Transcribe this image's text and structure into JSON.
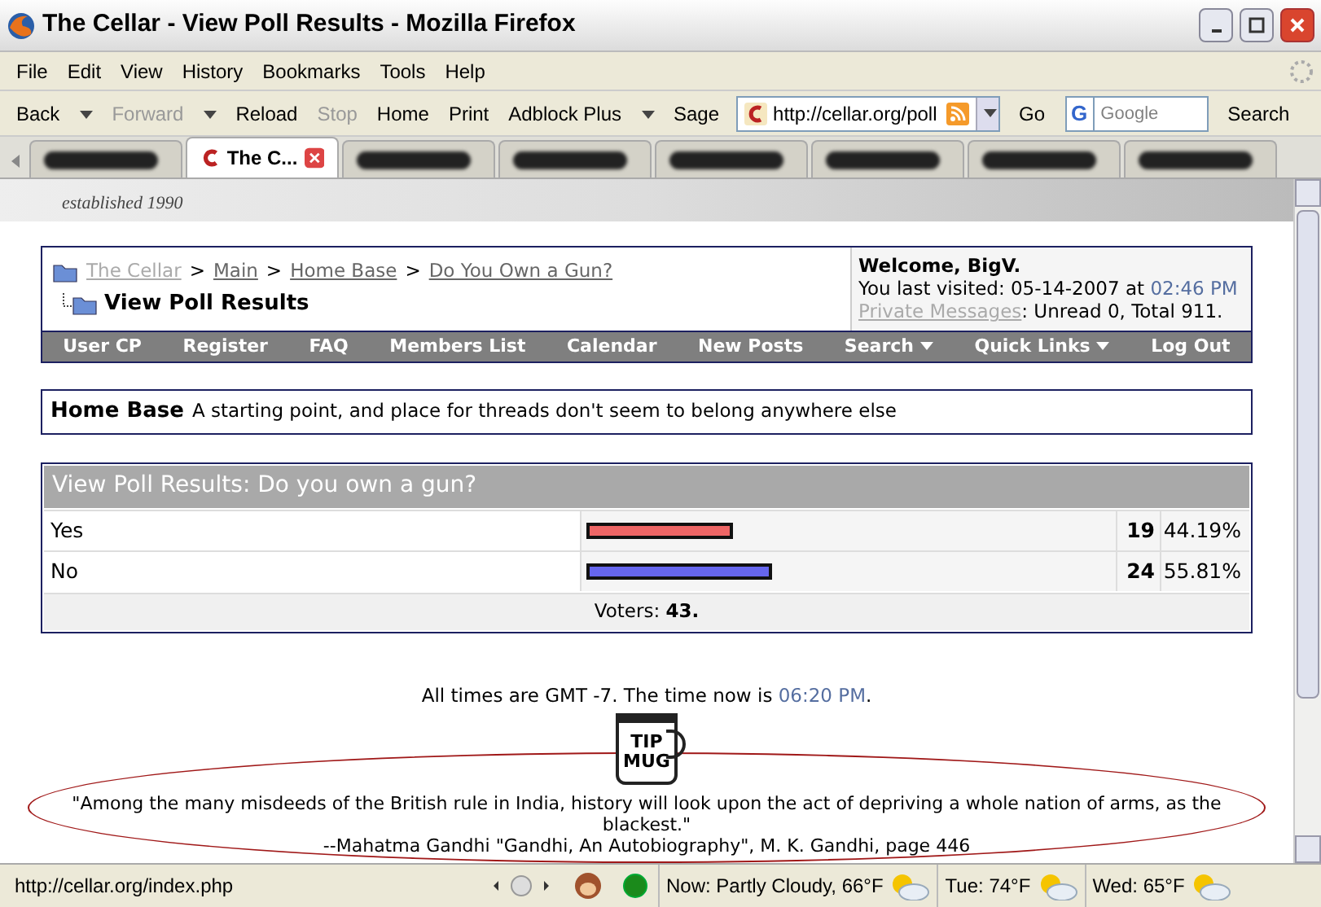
{
  "window": {
    "title": "The Cellar - View Poll Results - Mozilla Firefox"
  },
  "menu": [
    "File",
    "Edit",
    "View",
    "History",
    "Bookmarks",
    "Tools",
    "Help"
  ],
  "toolbar": [
    {
      "label": "Back",
      "disabled": false,
      "dropdown": true
    },
    {
      "label": "Forward",
      "disabled": true,
      "dropdown": true
    },
    {
      "label": "Reload",
      "disabled": false,
      "dropdown": false
    },
    {
      "label": "Stop",
      "disabled": true,
      "dropdown": false
    },
    {
      "label": "Home",
      "disabled": false,
      "dropdown": false
    },
    {
      "label": "Print",
      "disabled": false,
      "dropdown": false
    },
    {
      "label": "Adblock Plus",
      "disabled": false,
      "dropdown": true
    },
    {
      "label": "Sage",
      "disabled": false,
      "dropdown": false
    }
  ],
  "address": {
    "value": "http://cellar.org/poll",
    "go": "Go"
  },
  "search": {
    "engine": "G",
    "placeholder": "Google",
    "button": "Search"
  },
  "tabs": [
    {
      "selected": false
    },
    {
      "label": "The C...",
      "selected": true
    },
    {
      "selected": false
    },
    {
      "selected": false
    },
    {
      "selected": false
    },
    {
      "selected": false
    },
    {
      "selected": false
    },
    {
      "selected": false
    }
  ],
  "header": {
    "tagline": "established 1990"
  },
  "breadcrumb": {
    "links": [
      "The Cellar",
      "Main",
      "Home Base",
      "Do You Own a Gun?"
    ],
    "separator": ">",
    "current": "View Poll Results"
  },
  "welcome": {
    "greeting": "Welcome, BigV.",
    "visited": "You last visited: 05-14-2007 at",
    "visited_time": "02:46 PM",
    "pm_link": "Private Messages",
    "pm_text": ": Unread 0, Total 911."
  },
  "navbar": [
    {
      "label": "User CP",
      "dropdown": false
    },
    {
      "label": "Register",
      "dropdown": false
    },
    {
      "label": "FAQ",
      "dropdown": false
    },
    {
      "label": "Members List",
      "dropdown": false
    },
    {
      "label": "Calendar",
      "dropdown": false
    },
    {
      "label": "New Posts",
      "dropdown": false
    },
    {
      "label": "Search",
      "dropdown": true
    },
    {
      "label": "Quick Links",
      "dropdown": true
    },
    {
      "label": "Log Out",
      "dropdown": false
    }
  ],
  "forum": {
    "name": "Home Base",
    "description": "A starting point, and place for threads don't seem to belong anywhere else"
  },
  "poll": {
    "title": "View Poll Results: Do you own a gun?",
    "options": [
      {
        "label": "Yes",
        "votes": "19",
        "percent": "44.19%",
        "level": 0.28,
        "color": "#ee6666"
      },
      {
        "label": "No",
        "votes": "24",
        "percent": "55.81%",
        "level": 0.355,
        "color": "#6666ee"
      }
    ],
    "voters_label": "Voters:",
    "voters": "43."
  },
  "footer": {
    "times": "All times are GMT -7. The time now is",
    "time": "06:20 PM",
    "time_end": ".",
    "mug": [
      "TIP",
      "MUG"
    ],
    "quote": "\"Among the many misdeeds of the British rule in India, history will look upon the act of depriving a whole nation of arms, as the blackest.\"",
    "attribution": "--Mahatma Gandhi \"Gandhi, An Autobiography\", M. K. Gandhi, page 446"
  },
  "status_bar": {
    "url": "http://cellar.org/index.php",
    "weather": [
      {
        "label": "Now: Partly Cloudy, 66°F"
      },
      {
        "label": "Tue: 74°F"
      },
      {
        "label": "Wed: 65°F"
      }
    ]
  }
}
